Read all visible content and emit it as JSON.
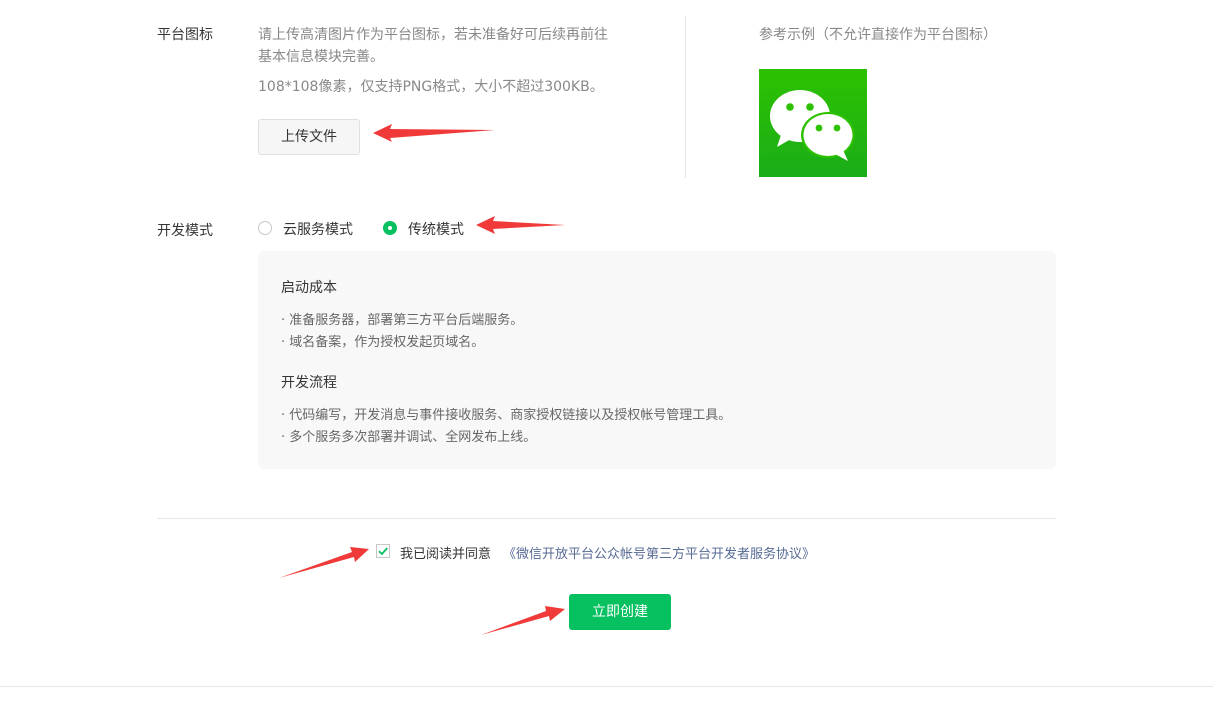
{
  "icon_section": {
    "label": "平台图标",
    "desc_line1": "请上传高清图片作为平台图标，若未准备好可后续再前往",
    "desc_line2": "基本信息模块完善。",
    "spec": "108*108像素，仅支持PNG格式，大小不超过300KB。",
    "upload_button": "上传文件",
    "example_label": "参考示例（不允许直接作为平台图标）",
    "example_icon": "wechat-logo-icon"
  },
  "dev_mode": {
    "label": "开发模式",
    "options": [
      {
        "label": "云服务模式",
        "selected": false
      },
      {
        "label": "传统模式",
        "selected": true
      }
    ]
  },
  "info": {
    "cost_title": "启动成本",
    "cost_items": [
      "·  准备服务器，部署第三方平台后端服务。",
      "·  域名备案，作为授权发起页域名。"
    ],
    "flow_title": "开发流程",
    "flow_items": [
      "·  代码编写，开发消息与事件接收服务、商家授权链接以及授权帐号管理工具。",
      "·  多个服务多次部署并调试、全网发布上线。"
    ]
  },
  "agreement": {
    "checked": true,
    "text": "我已阅读并同意",
    "link": "《微信开放平台公众帐号第三方平台开发者服务协议》"
  },
  "create_button": "立即创建",
  "colors": {
    "primary_green": "#07c160",
    "link_blue": "#576b95",
    "annotation_arrow": "#f03a3a"
  }
}
